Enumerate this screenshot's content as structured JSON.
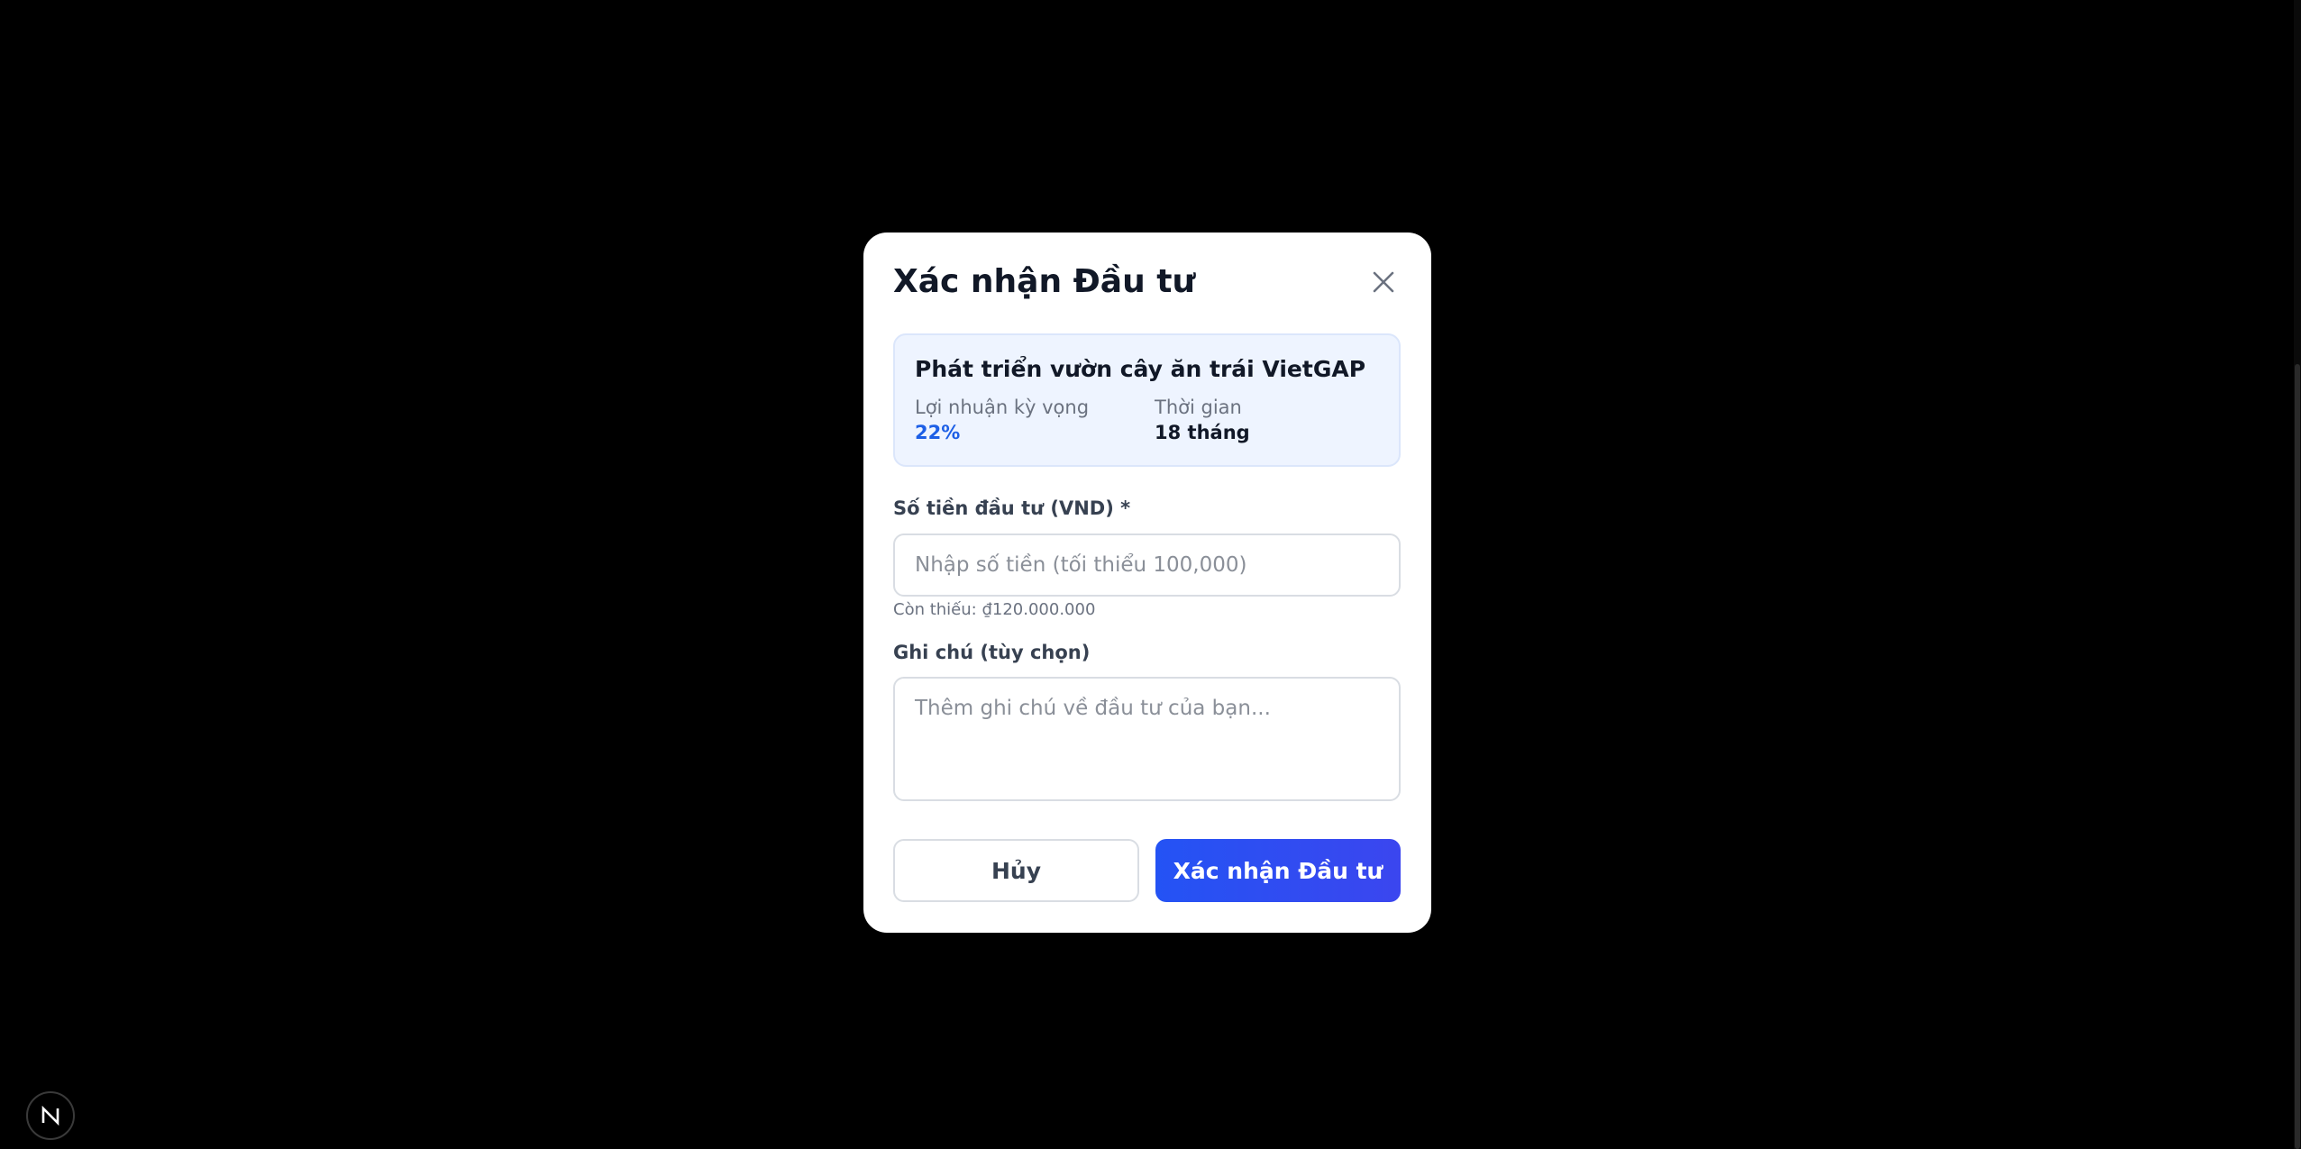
{
  "modal": {
    "title": "Xác nhận Đầu tư",
    "close_icon": "close-icon"
  },
  "project": {
    "name": "Phát triển vườn cây ăn trái VietGAP",
    "return_label": "Lợi nhuận kỳ vọng",
    "return_value": "22%",
    "duration_label": "Thời gian",
    "duration_value": "18 tháng"
  },
  "form": {
    "amount_label": "Số tiền đầu tư (VND) *",
    "amount_value": "",
    "amount_placeholder": "Nhập số tiền (tối thiểu 100,000)",
    "remaining_text": "Còn thiếu: ₫120.000.000",
    "note_label": "Ghi chú (tùy chọn)",
    "note_value": "",
    "note_placeholder": "Thêm ghi chú về đầu tư của bạn..."
  },
  "actions": {
    "cancel_label": "Hủy",
    "confirm_label": "Xác nhận Đầu tư"
  },
  "dev_badge": {
    "letter": "N",
    "icon": "nextjs-logo-icon"
  },
  "colors": {
    "accent": "#2453f4",
    "return_value": "#1d5fe6",
    "card_bg": "#eef4ff",
    "backdrop": "#000000"
  }
}
